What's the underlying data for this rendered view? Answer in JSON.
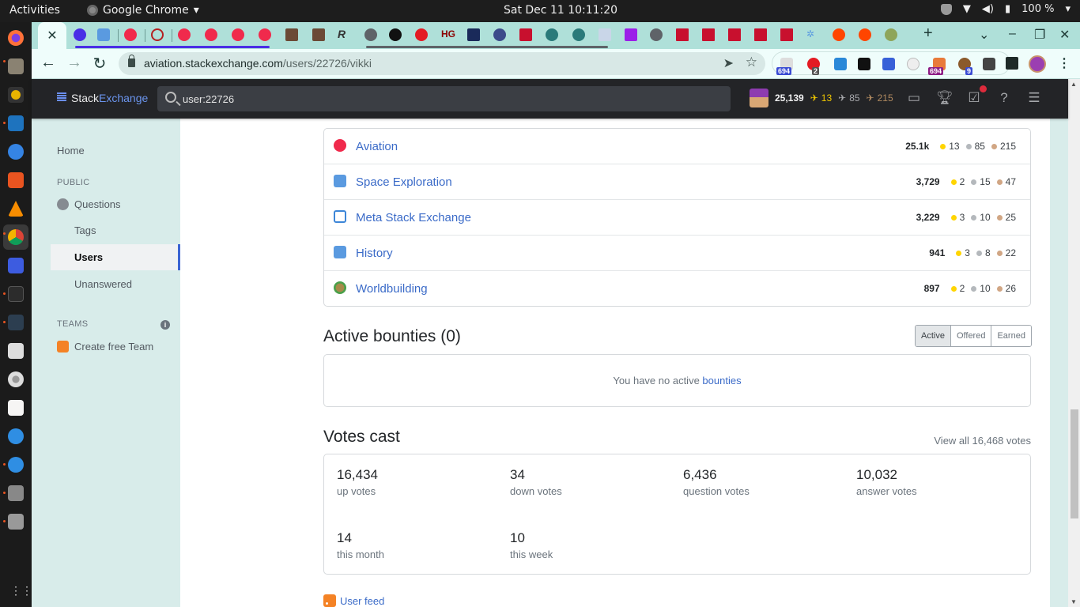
{
  "os": {
    "activities": "Activities",
    "app_menu": "Google Chrome",
    "clock": "Sat Dec 11  10:11:20",
    "battery": "100 %"
  },
  "dock": {
    "items": [
      "firefox-icon",
      "files-icon",
      "rhythmbox-icon",
      "writer-icon",
      "help-icon",
      "software-icon",
      "vlc-icon",
      "chrome-icon",
      "screenshot-icon",
      "terminal-icon",
      "system-monitor-icon",
      "settings-icon",
      "disk-icon",
      "text-editor-icon",
      "network-icon",
      "network2-icon",
      "usb-icon",
      "usb2-icon"
    ],
    "show_apps": "⋮⋮⋮"
  },
  "browser": {
    "close_tab": "✕",
    "new_tab": "+",
    "url_host": "aviation.stackexchange.com",
    "url_path": "/users/22726/vikki",
    "ext_badges": {
      "first": "694",
      "abp": "2",
      "seventh": "694",
      "cookie": "9"
    }
  },
  "se_header": {
    "logo_word1": "Stack",
    "logo_word2": "Exchange",
    "search_value": "user:22726",
    "reputation": "25,139",
    "gold": "13",
    "silver": "85",
    "bronze": "215"
  },
  "left_nav": {
    "home": "Home",
    "public_heading": "PUBLIC",
    "questions": "Questions",
    "tags": "Tags",
    "users": "Users",
    "unanswered": "Unanswered",
    "teams_heading": "TEAMS",
    "create_team": "Create free Team"
  },
  "accounts": [
    {
      "name": "Aviation",
      "rep": "25.1k",
      "gold": "13",
      "silver": "85",
      "bronze": "215",
      "icon": "aviation-icon"
    },
    {
      "name": "Space Exploration",
      "rep": "3,729",
      "gold": "2",
      "silver": "15",
      "bronze": "47",
      "icon": "space-exploration-icon"
    },
    {
      "name": "Meta Stack Exchange",
      "rep": "3,229",
      "gold": "3",
      "silver": "10",
      "bronze": "25",
      "icon": "meta-icon"
    },
    {
      "name": "History",
      "rep": "941",
      "gold": "3",
      "silver": "8",
      "bronze": "22",
      "icon": "history-icon"
    },
    {
      "name": "Worldbuilding",
      "rep": "897",
      "gold": "2",
      "silver": "10",
      "bronze": "26",
      "icon": "worldbuilding-icon"
    }
  ],
  "bounties": {
    "title": "Active bounties (0)",
    "tabs": [
      "Active",
      "Offered",
      "Earned"
    ],
    "empty_text": "You have no active ",
    "empty_link": "bounties"
  },
  "votes": {
    "title": "Votes cast",
    "view_all": "View all 16,468 votes",
    "cells": [
      {
        "num": "16,434",
        "label": "up votes"
      },
      {
        "num": "34",
        "label": "down votes"
      },
      {
        "num": "6,436",
        "label": "question votes"
      },
      {
        "num": "10,032",
        "label": "answer votes"
      },
      {
        "num": "14",
        "label": "this month"
      },
      {
        "num": "10",
        "label": "this week"
      }
    ]
  },
  "user_feed": "User feed",
  "colors": {
    "gold": "#ffd500",
    "silver": "#b4b8bc",
    "bronze": "#d1a684",
    "link": "#3b6bc8",
    "tabstrip": "#afe0d9"
  }
}
